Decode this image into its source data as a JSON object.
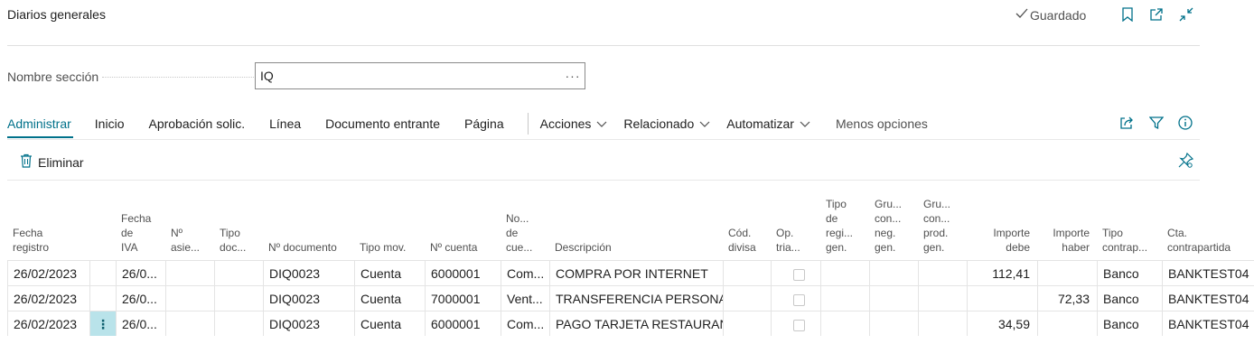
{
  "page": {
    "title": "Diarios generales",
    "saved_status": "Guardado"
  },
  "section": {
    "label": "Nombre sección",
    "value": "IQ",
    "more": "···"
  },
  "actions": {
    "tabs": [
      "Administrar",
      "Inicio",
      "Aprobación solic.",
      "Línea",
      "Documento entrante",
      "Página"
    ],
    "menus": [
      "Acciones",
      "Relacionado",
      "Automatizar"
    ],
    "less_options": "Menos opciones",
    "delete_label": "Eliminar"
  },
  "columns": [
    {
      "lines": [
        "Fecha",
        "registro"
      ]
    },
    {
      "lines": [
        ""
      ]
    },
    {
      "lines": [
        "Fecha",
        "de",
        "IVA"
      ]
    },
    {
      "lines": [
        "Nº",
        "asie..."
      ]
    },
    {
      "lines": [
        "Tipo",
        "doc..."
      ]
    },
    {
      "lines": [
        "Nº documento"
      ]
    },
    {
      "lines": [
        "Tipo mov."
      ]
    },
    {
      "lines": [
        "Nº cuenta"
      ]
    },
    {
      "lines": [
        "No...",
        "de",
        "cue..."
      ]
    },
    {
      "lines": [
        "Descripción"
      ]
    },
    {
      "lines": [
        "Cód.",
        "divisa"
      ]
    },
    {
      "lines": [
        "Op.",
        "tria..."
      ]
    },
    {
      "lines": [
        "Tipo",
        "de",
        "regi...",
        "gen."
      ]
    },
    {
      "lines": [
        "Gru...",
        "con...",
        "neg.",
        "gen."
      ]
    },
    {
      "lines": [
        "Gru...",
        "con...",
        "prod.",
        "gen."
      ]
    },
    {
      "lines": [
        "Importe",
        "debe"
      ]
    },
    {
      "lines": [
        "Importe",
        "haber"
      ]
    },
    {
      "lines": [
        "Tipo",
        "contrap..."
      ]
    },
    {
      "lines": [
        "Cta.",
        "contrapartida"
      ]
    }
  ],
  "rows": [
    {
      "fecha": "26/02/2023",
      "fecha_iva": "26/0...",
      "num_asiento": "",
      "tipo_doc": "",
      "num_doc": "DIQ0023",
      "tipo_mov": "Cuenta",
      "num_cuenta": "6000001",
      "nombre_cuenta": "Com...",
      "descripcion": "COMPRA POR INTERNET",
      "divisa": "",
      "debe": "112,41",
      "haber": "",
      "tipo_contra": "Banco",
      "cta_contra": "BANKTEST04",
      "selected": false
    },
    {
      "fecha": "26/02/2023",
      "fecha_iva": "26/0...",
      "num_asiento": "",
      "tipo_doc": "",
      "num_doc": "DIQ0023",
      "tipo_mov": "Cuenta",
      "num_cuenta": "7000001",
      "nombre_cuenta": "Vent...",
      "descripcion": "TRANSFERENCIA PERSONAL",
      "divisa": "",
      "debe": "",
      "haber": "72,33",
      "tipo_contra": "Banco",
      "cta_contra": "BANKTEST04",
      "selected": false
    },
    {
      "fecha": "26/02/2023",
      "fecha_iva": "26/0...",
      "num_asiento": "",
      "tipo_doc": "",
      "num_doc": "DIQ0023",
      "tipo_mov": "Cuenta",
      "num_cuenta": "6000001",
      "nombre_cuenta": "Com...",
      "descripcion": "PAGO TARJETA RESTAURAN...",
      "divisa": "",
      "debe": "34,59",
      "haber": "",
      "tipo_contra": "Banco",
      "cta_contra": "BANKTEST04",
      "selected": true
    }
  ],
  "colors": {
    "accent": "#00718a",
    "selected_cell": "#b9e3ea"
  },
  "icons": [
    "checkmark-icon",
    "bookmark-icon",
    "open-new-window-icon",
    "collapse-icon",
    "trash-icon",
    "share-icon",
    "filter-icon",
    "info-icon",
    "personalize-pin-icon",
    "chevron-down-icon"
  ]
}
